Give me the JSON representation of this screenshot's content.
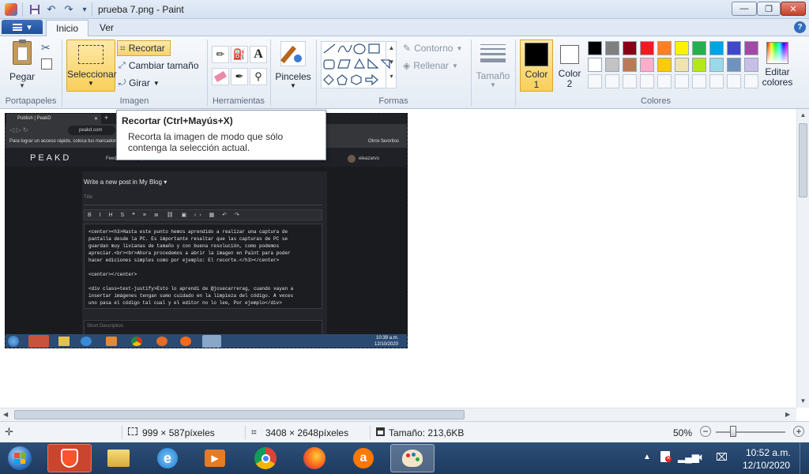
{
  "window": {
    "title": "prueba 7.png - Paint"
  },
  "window_buttons": {
    "minimize": "—",
    "maximize": "❐",
    "close": "✕"
  },
  "tabs": {
    "file": "▾",
    "home": "Inicio",
    "view": "Ver"
  },
  "clipboard": {
    "paste": "Pegar",
    "group": "Portapapeles"
  },
  "image": {
    "select": "Seleccionar",
    "crop": "Recortar",
    "resize": "Cambiar tamaño",
    "rotate": "Girar",
    "group": "Imagen"
  },
  "tools": {
    "group": "Herramientas"
  },
  "brushes": {
    "label": "Pinceles"
  },
  "shapes": {
    "outline": "Contorno",
    "fill": "Rellenar",
    "group": "Formas"
  },
  "size": {
    "label": "Tamaño"
  },
  "colors": {
    "color1": "Color 1",
    "color2": "Color 2",
    "edit": "Editar colores",
    "group": "Colores",
    "color1_value": "#000000",
    "color2_value": "#ffffff",
    "palette_row1": [
      "#000000",
      "#7f7f7f",
      "#880015",
      "#ed1c24",
      "#ff7f27",
      "#fff200",
      "#22b14c",
      "#00a2e8",
      "#3f48cc",
      "#a349a4"
    ],
    "palette_row2": [
      "#ffffff",
      "#c3c3c3",
      "#b97a57",
      "#ffaec9",
      "#ffc90e",
      "#efe4b0",
      "#b5e61d",
      "#99d9ea",
      "#7092be",
      "#c8bfe7"
    ]
  },
  "tooltip": {
    "title": "Recortar (Ctrl+Mayús+X)",
    "body": "Recorta la imagen de modo que sólo contenga la selección actual."
  },
  "status": {
    "selection_size": "999 × 587píxeles",
    "image_size": "3408 × 2648píxeles",
    "file_size": "Tamaño: 213,6KB",
    "zoom": "50%"
  },
  "taskbar": {
    "time": "10:52 a.m.",
    "date": "12/10/2020"
  },
  "shot": {
    "browser_tab": "Publish | PeakD",
    "url": "peakd.com",
    "bookmarks_hint": "Para lograr un acceso rápido, coloca tus marcadores",
    "other_bookmarks": "Otros favoritos",
    "brand": "PEAKD",
    "nav_feeds": "Feeds",
    "nav_explore": "Explore",
    "nav_communities": "Communities",
    "user": "eleazarvo",
    "editor_heading_prefix": "Write a new post in",
    "editor_heading_blog": "My Blog",
    "title_placeholder": "Title",
    "code_lines": [
      "<center><h3>Hasta este punto hemos aprendido a realizar una captura de",
      "pantalla desde la PC. Es importante resaltar que las capturas de PC se",
      "guardan muy livianas de tamaño y con buena resolución, como podemos",
      "apreciar.<br><br>Ahora procedemos a abrir la imagen en Paint para poder",
      "hacer ediciones simples como por ejemplo: El recorte.</h3></center>",
      "",
      "<center></center>",
      "",
      "<div class=text-justify>Esto lo aprendí de @josecarrerag, cuando vayan a",
      "insertar imágenes tengan sumo cuidado en la limpieza del código. A veces",
      "uno pasa el código tal cual y el editor no lo lee, Por ejemplo</div>"
    ],
    "short_description": "Short Description",
    "time": "10:39 a.m.",
    "date": "12/10/2020"
  }
}
